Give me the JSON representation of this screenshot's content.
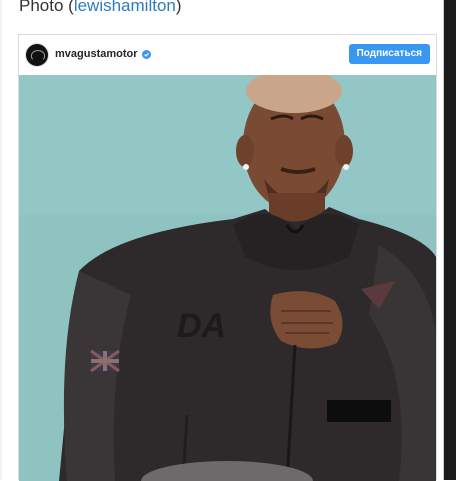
{
  "page": {
    "heading_prefix": "Photo (",
    "heading_link": "lewishamilton",
    "heading_suffix": ")"
  },
  "post": {
    "username": "mvagustamotor",
    "verified": true,
    "follow_label": "Подписаться",
    "accent_color": "#3897f0"
  },
  "icons": {
    "avatar": "brand-logo-avatar",
    "verified": "verified-badge-icon"
  }
}
